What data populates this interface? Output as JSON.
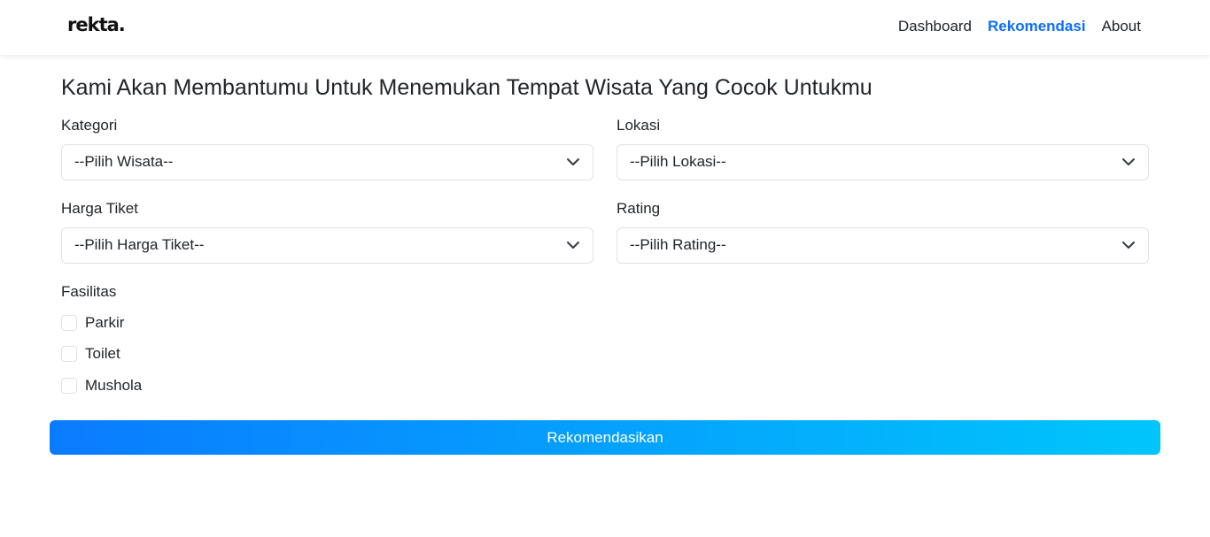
{
  "navbar": {
    "brand": "rekta.",
    "links": [
      "Dashboard",
      "Rekomendasi",
      "About"
    ]
  },
  "page_title": "Kami Akan Membantumu Untuk Menemukan Tempat Wisata Yang Cocok Untukmu",
  "form": {
    "kategori": {
      "label": "Kategori",
      "selected": "--Pilih Wisata--"
    },
    "lokasi": {
      "label": "Lokasi",
      "selected": "--Pilih Lokasi--"
    },
    "harga": {
      "label": "Harga Tiket",
      "selected": "--Pilih Harga Tiket--"
    },
    "rating": {
      "label": "Rating",
      "selected": "--Pilih Rating--"
    },
    "fasilitas": {
      "label": "Fasilitas",
      "options": [
        "Parkir",
        "Toilet",
        "Mushola"
      ]
    },
    "submit_label": "Rekomendasikan"
  },
  "colors": {
    "accent": "#0d6efd",
    "button_gradient_start": "#0a7bff",
    "button_gradient_end": "#00c6fb"
  }
}
